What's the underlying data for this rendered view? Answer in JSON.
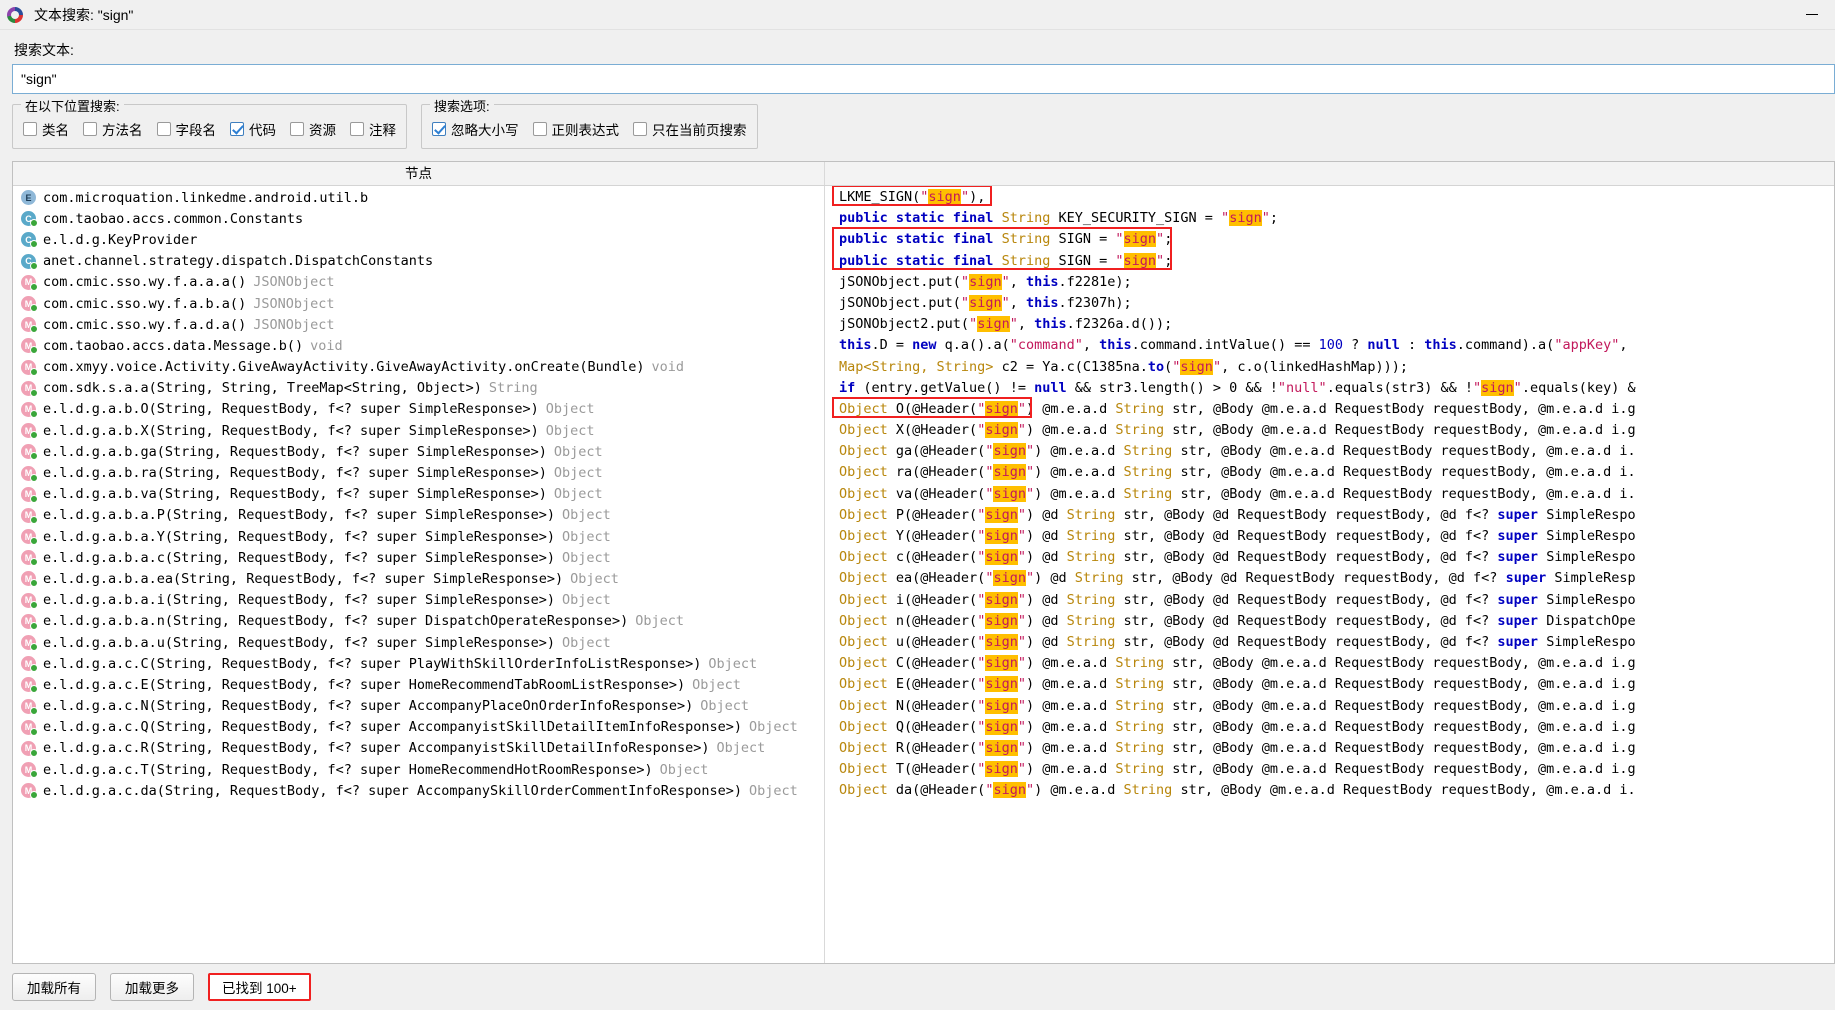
{
  "window": {
    "title": "文本搜索: \"sign\"",
    "icon": "app-logo-icon",
    "minimize_label": "—"
  },
  "search": {
    "label": "搜索文本:",
    "value": "\"sign\"",
    "placeholder": "搜索文本"
  },
  "scope_group": {
    "legend": "在以下位置搜索:",
    "options": [
      {
        "label": "类名",
        "checked": false
      },
      {
        "label": "方法名",
        "checked": false
      },
      {
        "label": "字段名",
        "checked": false
      },
      {
        "label": "代码",
        "checked": true
      },
      {
        "label": "资源",
        "checked": false
      },
      {
        "label": "注释",
        "checked": false
      }
    ]
  },
  "options_group": {
    "legend": "搜索选项:",
    "options": [
      {
        "label": "忽略大小写",
        "checked": true
      },
      {
        "label": "正则表达式",
        "checked": false
      },
      {
        "label": "只在当前页搜索",
        "checked": false
      }
    ]
  },
  "results": {
    "column_header_node": "节点",
    "nodes": [
      {
        "icon": "enum-icon",
        "kind": "e",
        "text": "com.microquation.linkedme.android.util.b",
        "ret": ""
      },
      {
        "icon": "class-icon",
        "kind": "c",
        "text": "com.taobao.accs.common.Constants",
        "ret": ""
      },
      {
        "icon": "class-icon",
        "kind": "c",
        "text": "e.l.d.g.KeyProvider",
        "ret": ""
      },
      {
        "icon": "class-icon",
        "kind": "c",
        "text": "anet.channel.strategy.dispatch.DispatchConstants",
        "ret": ""
      },
      {
        "icon": "method-icon",
        "kind": "m",
        "text": "com.cmic.sso.wy.f.a.a.a()",
        "ret": "JSONObject"
      },
      {
        "icon": "method-icon",
        "kind": "m",
        "text": "com.cmic.sso.wy.f.a.b.a()",
        "ret": "JSONObject"
      },
      {
        "icon": "method-icon",
        "kind": "m",
        "text": "com.cmic.sso.wy.f.a.d.a()",
        "ret": "JSONObject"
      },
      {
        "icon": "method-icon",
        "kind": "m",
        "text": "com.taobao.accs.data.Message.b()",
        "ret": "void"
      },
      {
        "icon": "method-icon",
        "kind": "m",
        "text": "com.xmyy.voice.Activity.GiveAwayActivity.GiveAwayActivity.onCreate(Bundle)",
        "ret": "void"
      },
      {
        "icon": "method-icon",
        "kind": "m",
        "text": "com.sdk.s.a.a(String, String, TreeMap<String, Object>)",
        "ret": "String"
      },
      {
        "icon": "method-icon",
        "kind": "m",
        "text": "e.l.d.g.a.b.O(String, RequestBody, f<? super SimpleResponse>)",
        "ret": "Object"
      },
      {
        "icon": "method-icon",
        "kind": "m",
        "text": "e.l.d.g.a.b.X(String, RequestBody, f<? super SimpleResponse>)",
        "ret": "Object"
      },
      {
        "icon": "method-icon",
        "kind": "m",
        "text": "e.l.d.g.a.b.ga(String, RequestBody, f<? super SimpleResponse>)",
        "ret": "Object"
      },
      {
        "icon": "method-icon",
        "kind": "m",
        "text": "e.l.d.g.a.b.ra(String, RequestBody, f<? super SimpleResponse>)",
        "ret": "Object"
      },
      {
        "icon": "method-icon",
        "kind": "m",
        "text": "e.l.d.g.a.b.va(String, RequestBody, f<? super SimpleResponse>)",
        "ret": "Object"
      },
      {
        "icon": "method-icon",
        "kind": "m",
        "text": "e.l.d.g.a.b.a.P(String, RequestBody, f<? super SimpleResponse>)",
        "ret": "Object"
      },
      {
        "icon": "method-icon",
        "kind": "m",
        "text": "e.l.d.g.a.b.a.Y(String, RequestBody, f<? super SimpleResponse>)",
        "ret": "Object"
      },
      {
        "icon": "method-icon",
        "kind": "m",
        "text": "e.l.d.g.a.b.a.c(String, RequestBody, f<? super SimpleResponse>)",
        "ret": "Object"
      },
      {
        "icon": "method-icon",
        "kind": "m",
        "text": "e.l.d.g.a.b.a.ea(String, RequestBody, f<? super SimpleResponse>)",
        "ret": "Object"
      },
      {
        "icon": "method-icon",
        "kind": "m",
        "text": "e.l.d.g.a.b.a.i(String, RequestBody, f<? super SimpleResponse>)",
        "ret": "Object"
      },
      {
        "icon": "method-icon",
        "kind": "m",
        "text": "e.l.d.g.a.b.a.n(String, RequestBody, f<? super DispatchOperateResponse>)",
        "ret": "Object"
      },
      {
        "icon": "method-icon",
        "kind": "m",
        "text": "e.l.d.g.a.b.a.u(String, RequestBody, f<? super SimpleResponse>)",
        "ret": "Object"
      },
      {
        "icon": "method-icon",
        "kind": "m",
        "text": "e.l.d.g.a.c.C(String, RequestBody, f<? super PlayWithSkillOrderInfoListResponse>)",
        "ret": "Object"
      },
      {
        "icon": "method-icon",
        "kind": "m",
        "text": "e.l.d.g.a.c.E(String, RequestBody, f<? super HomeRecommendTabRoomListResponse>)",
        "ret": "Object"
      },
      {
        "icon": "method-icon",
        "kind": "m",
        "text": "e.l.d.g.a.c.N(String, RequestBody, f<? super AccompanyPlaceOnOrderInfoResponse>)",
        "ret": "Object"
      },
      {
        "icon": "method-icon",
        "kind": "m",
        "text": "e.l.d.g.a.c.Q(String, RequestBody, f<? super AccompanyistSkillDetailItemInfoResponse>)",
        "ret": "Object"
      },
      {
        "icon": "method-icon",
        "kind": "m",
        "text": "e.l.d.g.a.c.R(String, RequestBody, f<? super AccompanyistSkillDetailInfoResponse>)",
        "ret": "Object"
      },
      {
        "icon": "method-icon",
        "kind": "m",
        "text": "e.l.d.g.a.c.T(String, RequestBody, f<? super HomeRecommendHotRoomResponse>)",
        "ret": "Object"
      },
      {
        "icon": "method-icon",
        "kind": "m",
        "text": "e.l.d.g.a.c.da(String, RequestBody, f<? super AccompanySkillOrderCommentInfoResponse>)",
        "ret": "Object"
      }
    ],
    "code_lines": [
      {
        "html": "LKME_SIGN(<span class='pun'>\"</span><span class='hl'>sign</span><span class='pun'>\"</span>),",
        "boxed": true
      },
      {
        "html": "<span class='kw'>public static final</span> <span class='typ'>String</span> KEY_SECURITY_SIGN = <span class='pun'>\"</span><span class='hl'>sign</span><span class='pun'>\"</span>;",
        "boxed": false
      },
      {
        "html": "<span class='kw'>public static final</span> <span class='typ'>String</span> SIGN = <span class='pun'>\"</span><span class='hl'>sign</span><span class='pun'>\"</span>;",
        "boxed": "group-start"
      },
      {
        "html": "<span class='kw'>public static final</span> <span class='typ'>String</span> SIGN = <span class='pun'>\"</span><span class='hl'>sign</span><span class='pun'>\"</span>;",
        "boxed": "group-end"
      },
      {
        "html": "jSONObject.put(<span class='pun'>\"</span><span class='hl'>sign</span><span class='pun'>\"</span>, <span class='kw'>this</span>.f2281e);",
        "boxed": false
      },
      {
        "html": "jSONObject.put(<span class='pun'>\"</span><span class='hl'>sign</span><span class='pun'>\"</span>, <span class='kw'>this</span>.f2307h);",
        "boxed": false
      },
      {
        "html": "jSONObject2.put(<span class='pun'>\"</span><span class='hl'>sign</span><span class='pun'>\"</span>, <span class='kw'>this</span>.f2326a.d());",
        "boxed": false
      },
      {
        "html": "<span class='kw'>this</span>.D = <span class='kw'>new</span> q.a().a(<span class='str'>\"command\"</span>, <span class='kw'>this</span>.command.intValue() == <span class='num'>100</span> ? <span class='kw'>null</span> : <span class='kw'>this</span>.command).a(<span class='str'>\"appKey\"</span>,",
        "boxed": false
      },
      {
        "html": "<span class='typ'>Map&lt;String, String&gt;</span> c2 = Ya.c(C1385na.<span class='kw'>to</span>(<span class='pun'>\"</span><span class='hl'>sign</span><span class='pun'>\"</span>, c.o(linkedHashMap)));",
        "boxed": false
      },
      {
        "html": "<span class='kw'>if</span> (entry.getValue() != <span class='kw'>null</span> &amp;&amp; str3.length() &gt; 0 &amp;&amp; !<span class='str'>\"null\"</span>.equals(str3) &amp;&amp; !<span class='pun'>\"</span><span class='hl'>sign</span><span class='pun'>\"</span>.equals(key) &amp;",
        "boxed": false
      },
      {
        "html": "<span class='typ'>Object</span> O(@Header(<span class='pun'>\"</span><span class='hl'>sign</span><span class='pun'>\"</span>) @m.e.a.d <span class='typ'>String</span> str, @Body @m.e.a.d RequestBody requestBody, @m.e.a.d i.g",
        "boxed": true
      },
      {
        "html": "<span class='typ'>Object</span> X(@Header(<span class='pun'>\"</span><span class='hl'>sign</span><span class='pun'>\"</span>) @m.e.a.d <span class='typ'>String</span> str, @Body @m.e.a.d RequestBody requestBody, @m.e.a.d i.g",
        "boxed": false
      },
      {
        "html": "<span class='typ'>Object</span> ga(@Header(<span class='pun'>\"</span><span class='hl'>sign</span><span class='pun'>\"</span>) @m.e.a.d <span class='typ'>String</span> str, @Body @m.e.a.d RequestBody requestBody, @m.e.a.d i.",
        "boxed": false
      },
      {
        "html": "<span class='typ'>Object</span> ra(@Header(<span class='pun'>\"</span><span class='hl'>sign</span><span class='pun'>\"</span>) @m.e.a.d <span class='typ'>String</span> str, @Body @m.e.a.d RequestBody requestBody, @m.e.a.d i.",
        "boxed": false
      },
      {
        "html": "<span class='typ'>Object</span> va(@Header(<span class='pun'>\"</span><span class='hl'>sign</span><span class='pun'>\"</span>) @m.e.a.d <span class='typ'>String</span> str, @Body @m.e.a.d RequestBody requestBody, @m.e.a.d i.",
        "boxed": false
      },
      {
        "html": "<span class='typ'>Object</span> P(@Header(<span class='pun'>\"</span><span class='hl'>sign</span><span class='pun'>\"</span>) @d <span class='typ'>String</span> str, @Body @d RequestBody requestBody, @d f&lt;? <span class='kw'>super</span> SimpleRespo",
        "boxed": false
      },
      {
        "html": "<span class='typ'>Object</span> Y(@Header(<span class='pun'>\"</span><span class='hl'>sign</span><span class='pun'>\"</span>) @d <span class='typ'>String</span> str, @Body @d RequestBody requestBody, @d f&lt;? <span class='kw'>super</span> SimpleRespo",
        "boxed": false
      },
      {
        "html": "<span class='typ'>Object</span> c(@Header(<span class='pun'>\"</span><span class='hl'>sign</span><span class='pun'>\"</span>) @d <span class='typ'>String</span> str, @Body @d RequestBody requestBody, @d f&lt;? <span class='kw'>super</span> SimpleRespo",
        "boxed": false
      },
      {
        "html": "<span class='typ'>Object</span> ea(@Header(<span class='pun'>\"</span><span class='hl'>sign</span><span class='pun'>\"</span>) @d <span class='typ'>String</span> str, @Body @d RequestBody requestBody, @d f&lt;? <span class='kw'>super</span> SimpleResp",
        "boxed": false
      },
      {
        "html": "<span class='typ'>Object</span> i(@Header(<span class='pun'>\"</span><span class='hl'>sign</span><span class='pun'>\"</span>) @d <span class='typ'>String</span> str, @Body @d RequestBody requestBody, @d f&lt;? <span class='kw'>super</span> SimpleRespo",
        "boxed": false
      },
      {
        "html": "<span class='typ'>Object</span> n(@Header(<span class='pun'>\"</span><span class='hl'>sign</span><span class='pun'>\"</span>) @d <span class='typ'>String</span> str, @Body @d RequestBody requestBody, @d f&lt;? <span class='kw'>super</span> DispatchOpe",
        "boxed": false
      },
      {
        "html": "<span class='typ'>Object</span> u(@Header(<span class='pun'>\"</span><span class='hl'>sign</span><span class='pun'>\"</span>) @d <span class='typ'>String</span> str, @Body @d RequestBody requestBody, @d f&lt;? <span class='kw'>super</span> SimpleRespo",
        "boxed": false
      },
      {
        "html": "<span class='typ'>Object</span> C(@Header(<span class='pun'>\"</span><span class='hl'>sign</span><span class='pun'>\"</span>) @m.e.a.d <span class='typ'>String</span> str, @Body @m.e.a.d RequestBody requestBody, @m.e.a.d i.g",
        "boxed": false
      },
      {
        "html": "<span class='typ'>Object</span> E(@Header(<span class='pun'>\"</span><span class='hl'>sign</span><span class='pun'>\"</span>) @m.e.a.d <span class='typ'>String</span> str, @Body @m.e.a.d RequestBody requestBody, @m.e.a.d i.g",
        "boxed": false
      },
      {
        "html": "<span class='typ'>Object</span> N(@Header(<span class='pun'>\"</span><span class='hl'>sign</span><span class='pun'>\"</span>) @m.e.a.d <span class='typ'>String</span> str, @Body @m.e.a.d RequestBody requestBody, @m.e.a.d i.g",
        "boxed": false
      },
      {
        "html": "<span class='typ'>Object</span> Q(@Header(<span class='pun'>\"</span><span class='hl'>sign</span><span class='pun'>\"</span>) @m.e.a.d <span class='typ'>String</span> str, @Body @m.e.a.d RequestBody requestBody, @m.e.a.d i.g",
        "boxed": false
      },
      {
        "html": "<span class='typ'>Object</span> R(@Header(<span class='pun'>\"</span><span class='hl'>sign</span><span class='pun'>\"</span>) @m.e.a.d <span class='typ'>String</span> str, @Body @m.e.a.d RequestBody requestBody, @m.e.a.d i.g",
        "boxed": false
      },
      {
        "html": "<span class='typ'>Object</span> T(@Header(<span class='pun'>\"</span><span class='hl'>sign</span><span class='pun'>\"</span>) @m.e.a.d <span class='typ'>String</span> str, @Body @m.e.a.d RequestBody requestBody, @m.e.a.d i.g",
        "boxed": false
      },
      {
        "html": "<span class='typ'>Object</span> da(@Header(<span class='pun'>\"</span><span class='hl'>sign</span><span class='pun'>\"</span>) @m.e.a.d <span class='typ'>String</span> str, @Body @m.e.a.d RequestBody requestBody, @m.e.a.d i.",
        "boxed": false
      }
    ]
  },
  "footer": {
    "load_all_label": "加载所有",
    "load_more_label": "加载更多",
    "found_label": "已找到  100+"
  },
  "colors": {
    "highlight": "#ffbf00",
    "box_outline": "#f02020",
    "keyword": "#0000c0",
    "type": "#b8860b",
    "string": "#c2185b",
    "accent_border": "#7aadd4"
  }
}
